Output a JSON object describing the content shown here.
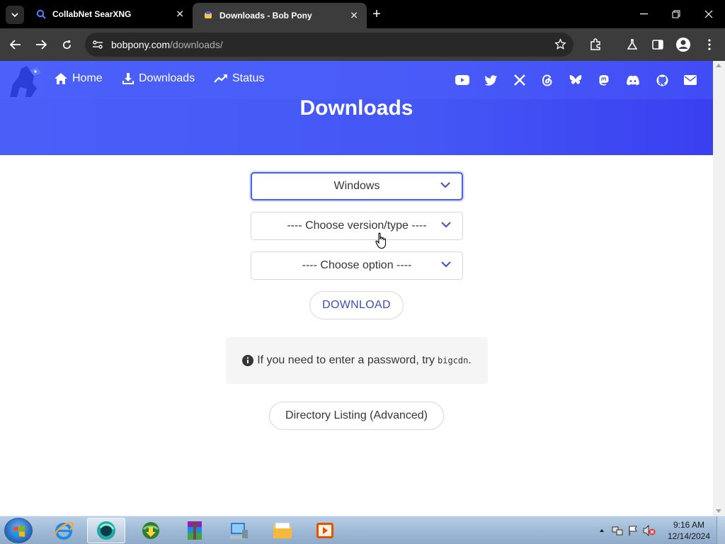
{
  "browser": {
    "tabs": [
      {
        "title": "CollabNet SearXNG",
        "active": false
      },
      {
        "title": "Downloads - Bob Pony",
        "active": true
      }
    ],
    "address": {
      "domain": "bobpony.com",
      "path": "/downloads/"
    }
  },
  "site": {
    "nav": {
      "home": "Home",
      "downloads": "Downloads",
      "status": "Status"
    },
    "social_icons": [
      "youtube-icon",
      "twitter-icon",
      "x-icon",
      "threads-icon",
      "bluesky-icon",
      "mastodon-icon",
      "discord-icon",
      "github-icon",
      "email-icon"
    ],
    "page_title": "Downloads",
    "accent_color": "#4a5ff8"
  },
  "form": {
    "os_select": {
      "value": "Windows"
    },
    "version_select": {
      "value": "---- Choose version/type ----"
    },
    "option_select": {
      "value": "---- Choose option ----"
    },
    "download_label": "DOWNLOAD",
    "notice_text": "If you need to enter a password, try",
    "notice_code": "bigcdn",
    "notice_end": ".",
    "directory_label": "Directory Listing (Advanced)"
  },
  "taskbar": {
    "time": "9:16 AM",
    "date": "12/14/2024"
  }
}
